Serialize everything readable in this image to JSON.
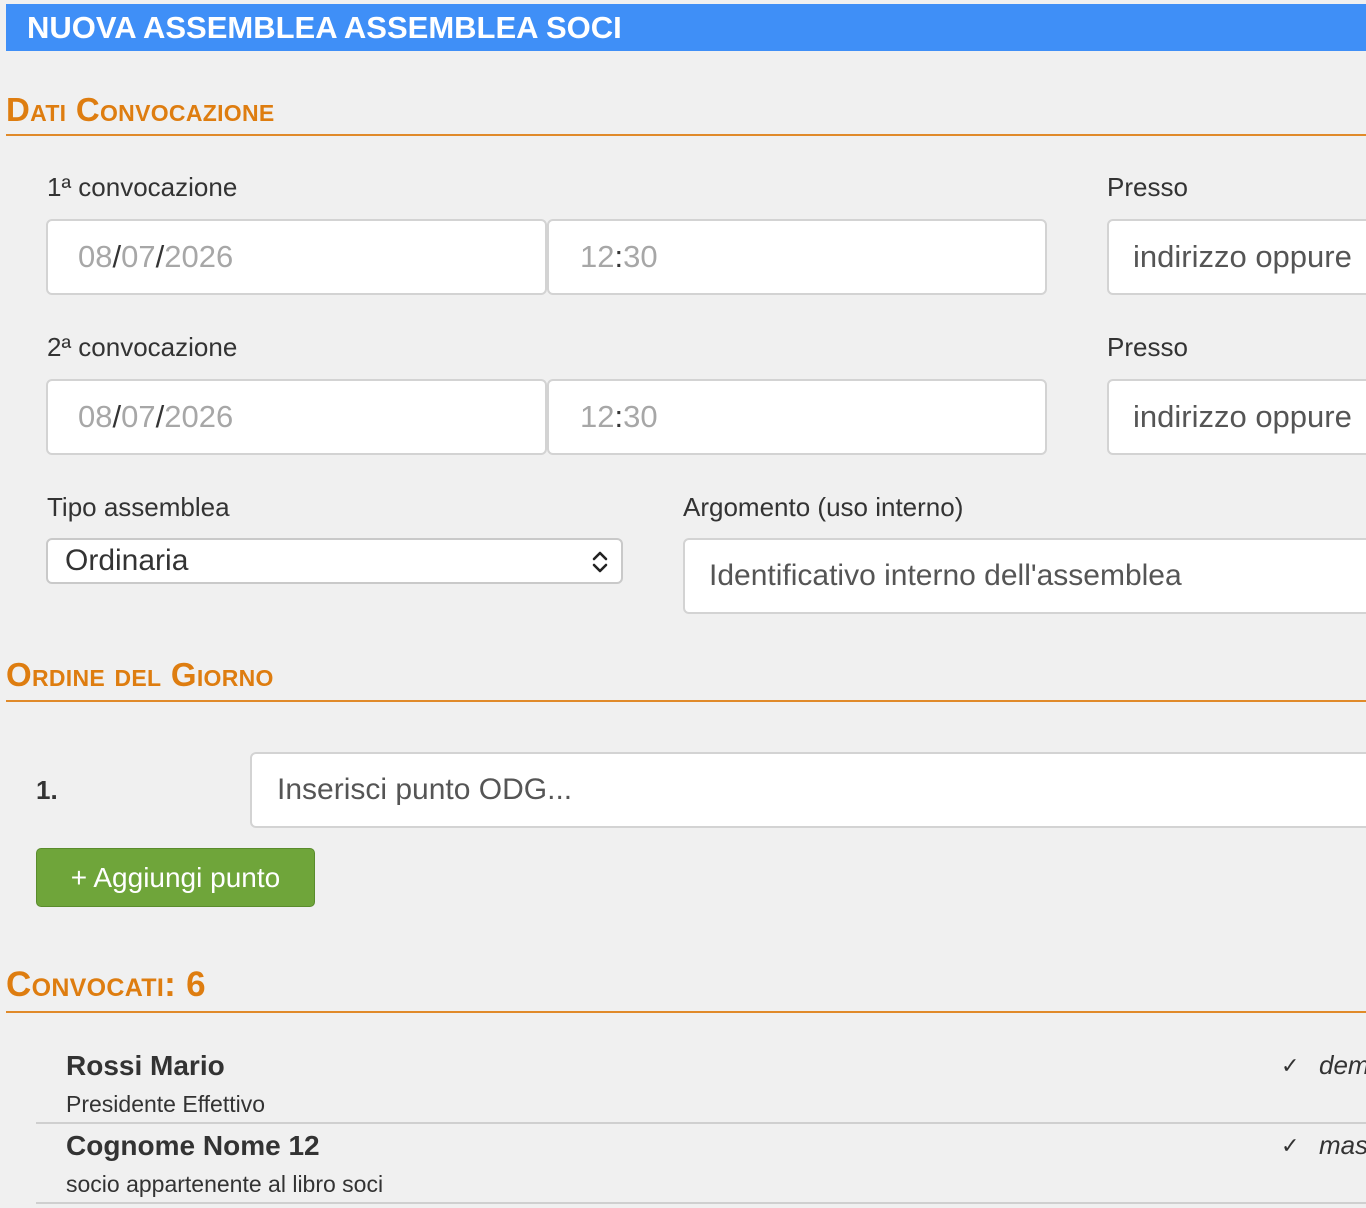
{
  "header": {
    "title": "NUOVA ASSEMBLEA ASSEMBLEA SOCI"
  },
  "sections": {
    "dati": "Dati Convocazione",
    "odg": "Ordine del Giorno",
    "convocati_label": "Convocati:",
    "convocati_count": "6"
  },
  "conv1": {
    "label": "1ª convocazione",
    "date": {
      "day": "08",
      "month": "07",
      "year": "2026",
      "sep": "/"
    },
    "time": {
      "hh": "12",
      "mm": "30",
      "sep": ":"
    },
    "presso_label": "Presso",
    "presso_placeholder": "indirizzo oppure"
  },
  "conv2": {
    "label": "2ª convocazione",
    "date": {
      "day": "08",
      "month": "07",
      "year": "2026",
      "sep": "/"
    },
    "time": {
      "hh": "12",
      "mm": "30",
      "sep": ":"
    },
    "presso_label": "Presso",
    "presso_placeholder": "indirizzo oppure"
  },
  "tipo": {
    "label": "Tipo assemblea",
    "value": "Ordinaria"
  },
  "argomento": {
    "label": "Argomento (uso interno)",
    "placeholder": "Identificativo interno dell'assemblea"
  },
  "odg": {
    "items": [
      {
        "number": "1.",
        "placeholder": "Inserisci punto ODG..."
      }
    ],
    "add_label": "+ Aggiungi punto"
  },
  "members": [
    {
      "name": "Rossi Mario",
      "role": "Presidente Effettivo",
      "check": "✓",
      "email": "dem"
    },
    {
      "name": "Cognome Nome 12",
      "role": "socio appartenente al libro soci",
      "check": "✓",
      "email": "mas"
    }
  ],
  "colors": {
    "header_bg": "#3f8ff7",
    "section": "#de7d10",
    "button": "#6fa53a"
  },
  "icons": {
    "select": "chevron-up-down-icon",
    "check": "check-icon"
  }
}
